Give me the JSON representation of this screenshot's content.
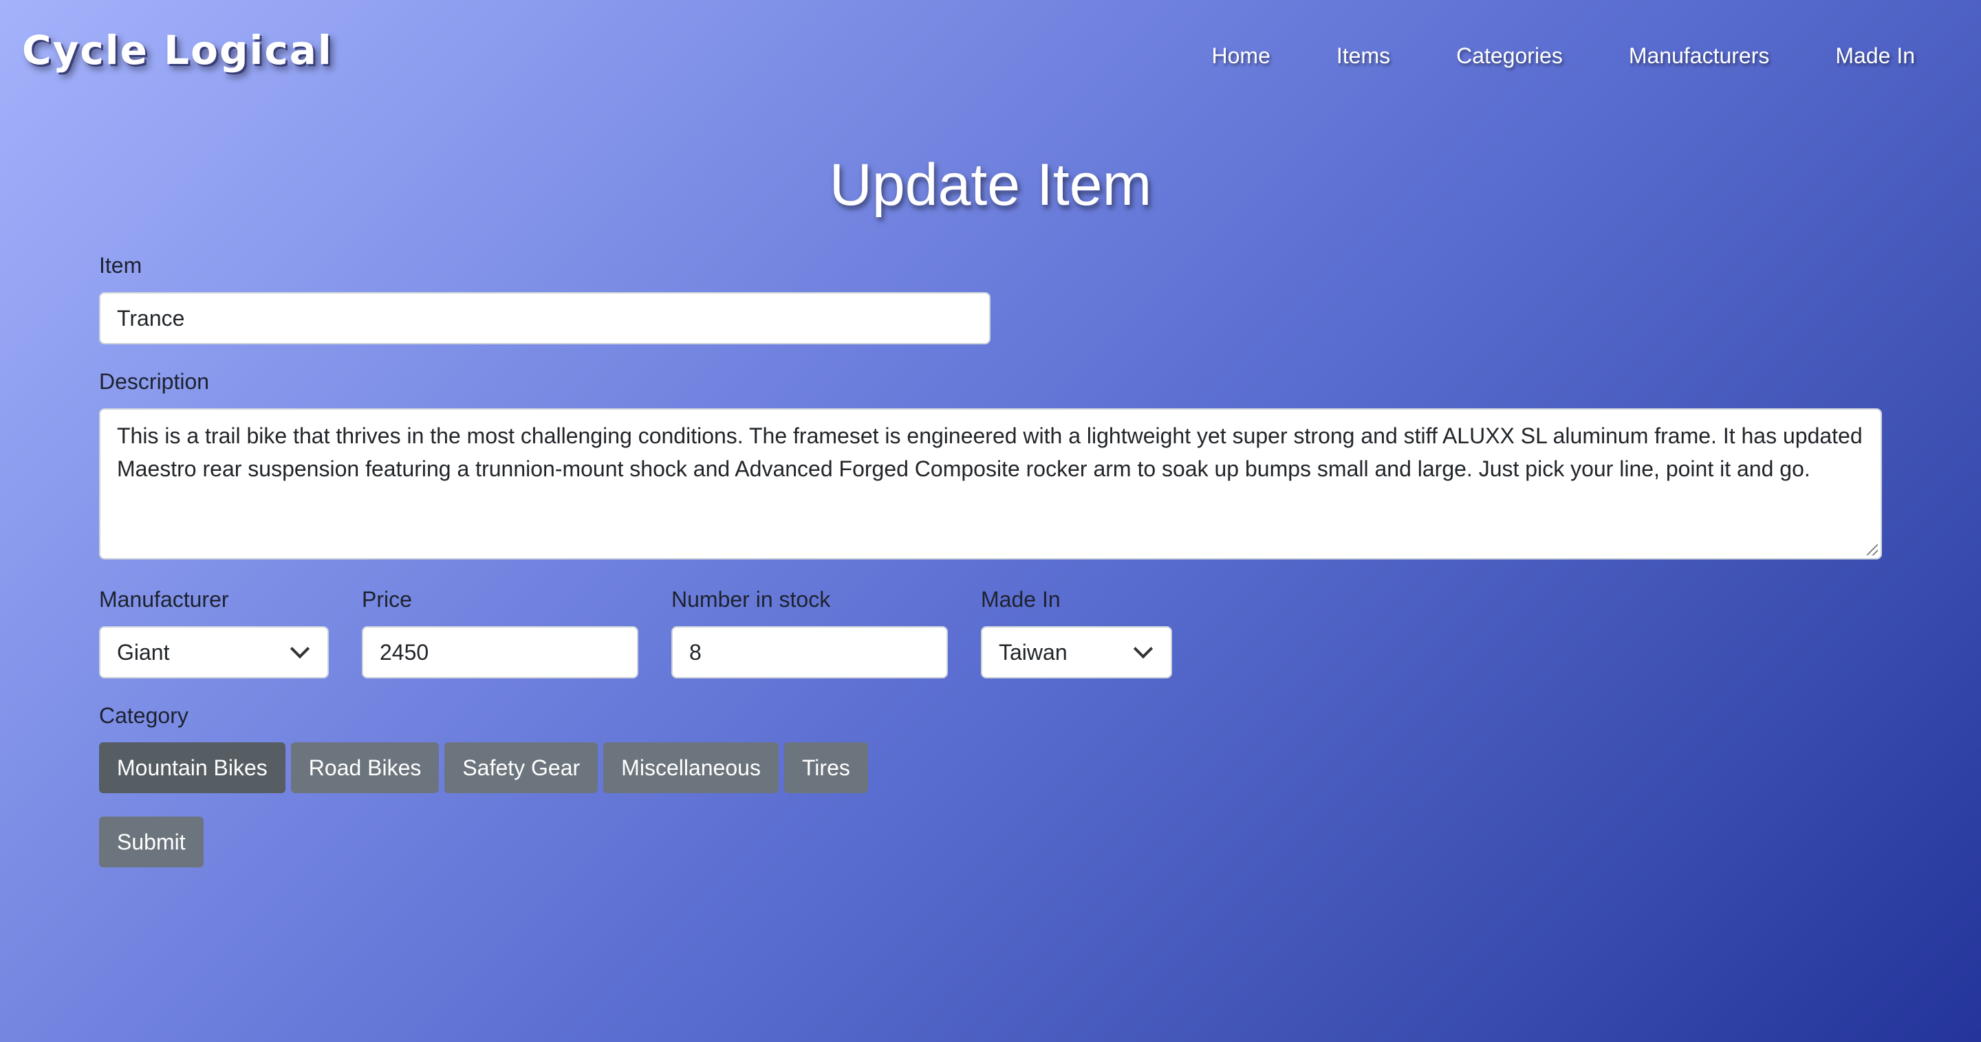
{
  "brand": {
    "logo_text": "Cycle Logical"
  },
  "nav": {
    "items": [
      {
        "label": "Home"
      },
      {
        "label": "Items"
      },
      {
        "label": "Categories"
      },
      {
        "label": "Manufacturers"
      },
      {
        "label": "Made In"
      }
    ]
  },
  "page": {
    "title": "Update Item"
  },
  "form": {
    "item": {
      "label": "Item",
      "value": "Trance"
    },
    "description": {
      "label": "Description",
      "value": "This is a trail bike that thrives in the most challenging conditions. The frameset is engineered with a lightweight yet super strong and stiff ALUXX SL aluminum frame. It has updated Maestro rear suspension featuring a trunnion-mount shock and Advanced Forged Composite rocker arm to soak up bumps small and large. Just pick your line, point it and go."
    },
    "manufacturer": {
      "label": "Manufacturer",
      "selected": "Giant"
    },
    "price": {
      "label": "Price",
      "value": "2450"
    },
    "stock": {
      "label": "Number in stock",
      "value": "8"
    },
    "made_in": {
      "label": "Made In",
      "selected": "Taiwan"
    },
    "category": {
      "label": "Category",
      "options": [
        {
          "label": "Mountain Bikes",
          "selected": true
        },
        {
          "label": "Road Bikes",
          "selected": false
        },
        {
          "label": "Safety Gear",
          "selected": false
        },
        {
          "label": "Miscellaneous",
          "selected": false
        },
        {
          "label": "Tires",
          "selected": false
        }
      ]
    },
    "submit_label": "Submit"
  },
  "colors": {
    "button": "#6c757d",
    "button_active": "#565e64",
    "gradient_start": "#a4b2fb",
    "gradient_end": "#24349a"
  }
}
